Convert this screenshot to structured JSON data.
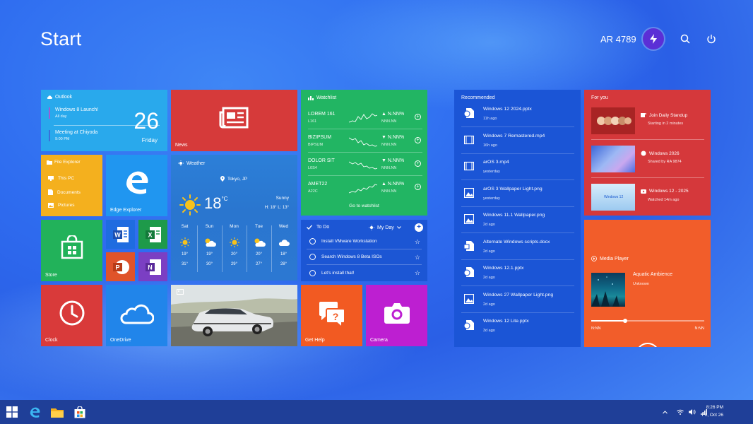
{
  "header": {
    "title": "Start",
    "user_name": "AR 4789"
  },
  "outlook": {
    "title": "Outlook",
    "events": [
      {
        "title": "Windows 8 Launch!",
        "time": "All day"
      },
      {
        "title": "Meeting at Chiyoda",
        "time": "9:00 PM"
      }
    ],
    "day": "26",
    "weekday": "Friday"
  },
  "news": {
    "label": "News"
  },
  "watchlist": {
    "title": "Watchlist",
    "stocks": [
      {
        "symbol": "LOREM 161",
        "sub": "L161",
        "pct": "▲ N.NN%",
        "value": "NNN.NN"
      },
      {
        "symbol": "BIZIPSUM",
        "sub": "BIPSUM",
        "pct": "▼ N.NN%",
        "value": "NNN.NN"
      },
      {
        "symbol": "DOLOR SIT",
        "sub": "L0S4",
        "pct": "▼ N.NN%",
        "value": "NNN.NN"
      },
      {
        "symbol": "AMET22",
        "sub": "A22C",
        "pct": "▲ N.NN%",
        "value": "NNN.NN"
      }
    ],
    "link": "Go to watchlist"
  },
  "file_explorer": {
    "title": "File Explorer",
    "items": [
      "This PC",
      "Documents",
      "Pictures"
    ]
  },
  "edge": {
    "label": "Edge Explorer"
  },
  "weather": {
    "title": "Weather",
    "location": "Tokyo, JP",
    "temp": "18",
    "unit": "°C",
    "condition": "Sunny",
    "hilo": "H: 18° L: 13°",
    "forecast": [
      {
        "day": "Sat",
        "hi": "19°",
        "lo": "31°",
        "icon": "sun-icon"
      },
      {
        "day": "Sun",
        "hi": "19°",
        "lo": "30°",
        "icon": "partly-cloudy-icon"
      },
      {
        "day": "Mon",
        "hi": "20°",
        "lo": "29°",
        "icon": "sun-icon"
      },
      {
        "day": "Tue",
        "hi": "20°",
        "lo": "27°",
        "icon": "partly-cloudy-icon"
      },
      {
        "day": "Wed",
        "hi": "18°",
        "lo": "28°",
        "icon": "cloud-icon"
      }
    ]
  },
  "store": {
    "label": "Store"
  },
  "todo": {
    "title": "To Do",
    "list": "My Day",
    "tasks": [
      "Install VMware Workstation",
      "Search Windows 8 Beta ISOs",
      "Let's install that!"
    ]
  },
  "clock": {
    "label": "Clock"
  },
  "onedrive": {
    "label": "OneDrive"
  },
  "gethelp": {
    "label": "Get Help"
  },
  "camera": {
    "label": "Camera"
  },
  "recommended": {
    "title": "Recommended",
    "items": [
      {
        "name": "Windows 12 2024.pptx",
        "time": "11h ago",
        "icon": "pptx-icon"
      },
      {
        "name": "Windows 7 Remastered.mp4",
        "time": "16h ago",
        "icon": "video-icon"
      },
      {
        "name": "arOS 3.mp4",
        "time": "yesterday",
        "icon": "video-icon"
      },
      {
        "name": "arOS 3 Wallpaper Light.png",
        "time": "yesterday",
        "icon": "image-icon"
      },
      {
        "name": "Windows 11.1 Wallpaper.png",
        "time": "2d ago",
        "icon": "image-icon"
      },
      {
        "name": "Alternate Windows scripts.docx",
        "time": "2d ago",
        "icon": "docx-icon"
      },
      {
        "name": "Windows 12.1.pptx",
        "time": "2d ago",
        "icon": "pptx-icon"
      },
      {
        "name": "Windows 27 Wallpaper Light.png",
        "time": "2d ago",
        "icon": "image-icon"
      },
      {
        "name": "Windows 12 Lite.pptx",
        "time": "3d ago",
        "icon": "pptx-icon"
      }
    ]
  },
  "foryou": {
    "title": "For you",
    "items": [
      {
        "title": "Join Daily Standup",
        "sub": "Starting in 2 minutes",
        "icon": "teams-icon"
      },
      {
        "title": "Windows 2026",
        "sub": "Shared by RA 9874",
        "icon": "chat-icon"
      },
      {
        "title": "Windows 12 - 2025",
        "sub": "Watched 14m ago",
        "icon": "youtube-icon"
      }
    ],
    "thumb3_text": "Windows 12"
  },
  "media": {
    "title": "Media Player",
    "song": "Aquatic Ambience",
    "artist": "Unknown",
    "progress": 0.3,
    "time_elapsed": "N:NN",
    "time_total": "N:NN"
  },
  "taskbar": {
    "time": "8:26 PM",
    "date": "Fri, Oct 26"
  },
  "colors": {
    "accent": "#2f6df0",
    "taskbar": "#1f3f98"
  }
}
